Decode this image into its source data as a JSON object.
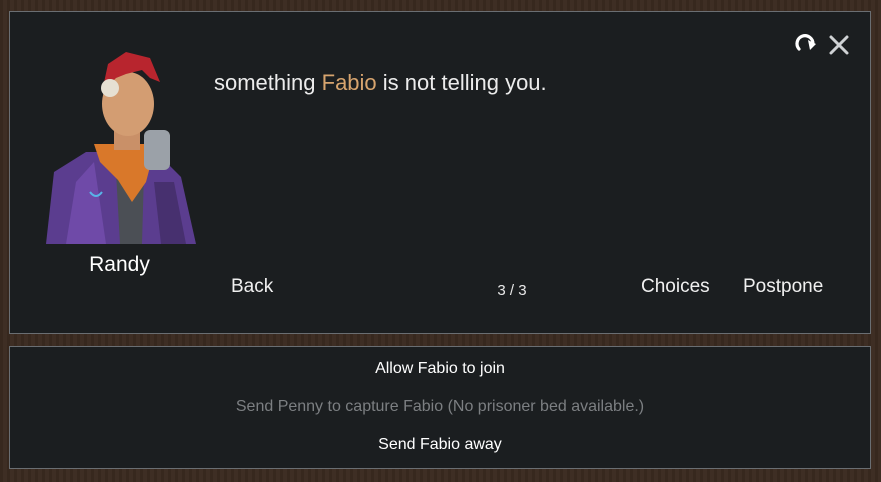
{
  "speaker": {
    "name": "Randy"
  },
  "message": {
    "before": "something ",
    "highlight": "Fabio",
    "after": " is not telling you."
  },
  "nav": {
    "back": "Back",
    "page": "3 / 3",
    "choices": "Choices",
    "postpone": "Postpone"
  },
  "icons": {
    "skip": "skip-forward-icon",
    "close": "close-icon"
  },
  "options": [
    {
      "label": "Allow Fabio to join",
      "enabled": true
    },
    {
      "label": "Send Penny to capture Fabio (No prisoner bed available.)",
      "enabled": false
    },
    {
      "label": "Send Fabio away",
      "enabled": true
    }
  ],
  "colors": {
    "highlight": "#d7a46e",
    "panel": "#1b1e20",
    "border": "#6a6e72",
    "frame": "#3a2a20"
  }
}
